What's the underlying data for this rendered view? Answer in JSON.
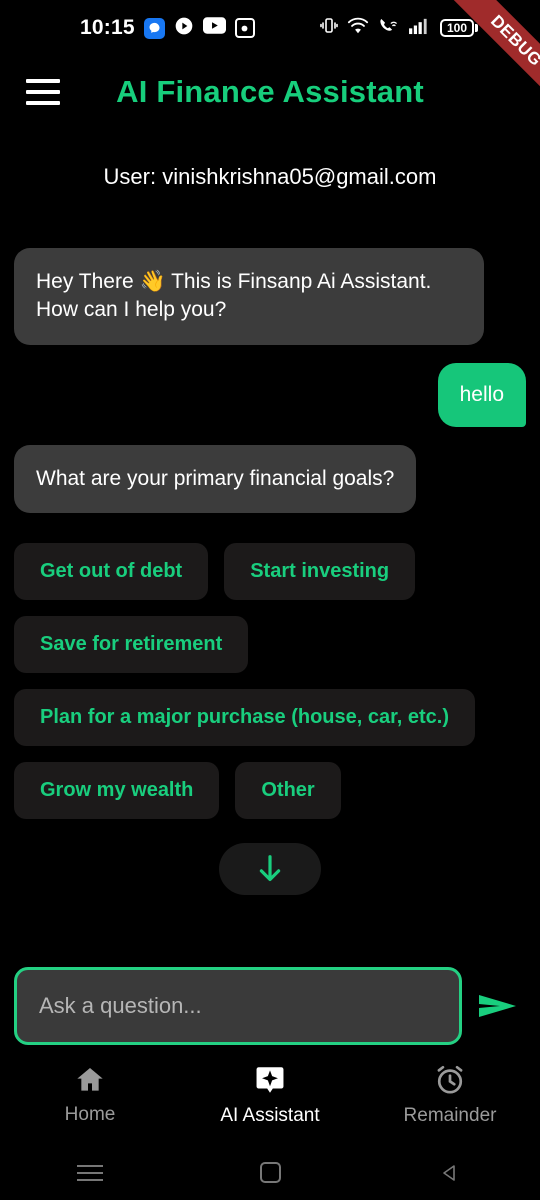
{
  "status_bar": {
    "time": "10:15",
    "notification_icons": [
      "messenger-icon",
      "play-circle-icon",
      "youtube-icon",
      "screenshot-icon"
    ],
    "system_icons": [
      "vibrate-icon",
      "wifi-icon",
      "call-wifi-icon",
      "signal-bars-icon"
    ],
    "battery_level": "100",
    "debug_ribbon_label": "DEBUG",
    "debug_ribbon_color": "#A02B2B"
  },
  "app_bar": {
    "menu_icon": "hamburger-menu-icon",
    "title": "AI Finance Assistant",
    "title_color": "#17CE7C"
  },
  "user_line": {
    "text": "User: vinishkrishna05@gmail.com"
  },
  "chat": {
    "messages": [
      {
        "sender": "assistant",
        "text": "Hey There 👋 This is Finsanp Ai Assistant. How can I help you?",
        "bubble_color": "#3C3C3C"
      },
      {
        "sender": "user",
        "text": "hello",
        "bubble_color": "#16C67A"
      },
      {
        "sender": "assistant",
        "text": "What are your primary financial goals?",
        "bubble_color": "#3C3C3C"
      }
    ]
  },
  "suggestions": {
    "chip_color": "#1C1A1A",
    "text_color": "#19CE7E",
    "items": [
      "Get out of debt",
      "Start investing",
      "Save for retirement",
      "Plan for a major purchase (house, car, etc.)",
      "Grow my wealth",
      "Other"
    ]
  },
  "scroll_down_button": {
    "icon": "arrow-down-icon",
    "color": "#19CE7E"
  },
  "composer": {
    "placeholder": "Ask a question...",
    "value": "",
    "border_color": "#24D083",
    "send_icon": "send-arrow-icon"
  },
  "bottom_nav": {
    "items": [
      {
        "label": "Home",
        "icon": "home-icon",
        "active": false
      },
      {
        "label": "AI Assistant",
        "icon": "ai-sparkle-icon",
        "active": true
      },
      {
        "label": "Remainder",
        "icon": "alarm-clock-icon",
        "active": false
      }
    ]
  },
  "system_nav": {
    "items": [
      "recents-icon",
      "home-square-icon",
      "back-triangle-icon"
    ]
  }
}
